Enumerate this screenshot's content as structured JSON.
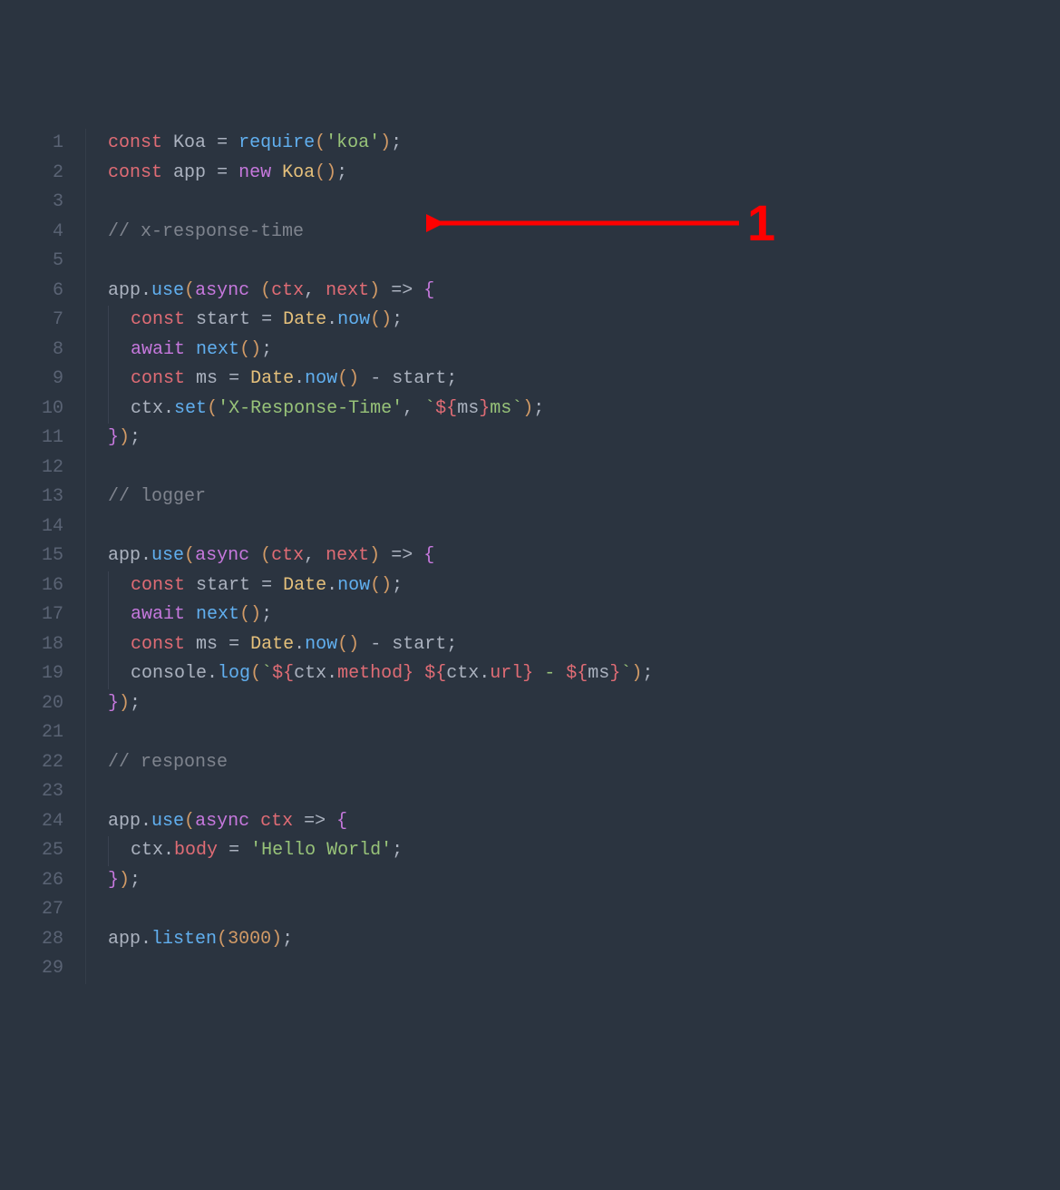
{
  "editor": {
    "lineCount": 29,
    "code": {
      "line1": [
        [
          "storage",
          "const"
        ],
        [
          "space",
          " "
        ],
        [
          "ident",
          "Koa"
        ],
        [
          "space",
          " "
        ],
        [
          "op",
          "="
        ],
        [
          "space",
          " "
        ],
        [
          "func",
          "require"
        ],
        [
          "paren",
          "("
        ],
        [
          "string",
          "'koa'"
        ],
        [
          "paren",
          ")"
        ],
        [
          "punct",
          ";"
        ]
      ],
      "line2": [
        [
          "storage",
          "const"
        ],
        [
          "space",
          " "
        ],
        [
          "ident",
          "app"
        ],
        [
          "space",
          " "
        ],
        [
          "op",
          "="
        ],
        [
          "space",
          " "
        ],
        [
          "keyword",
          "new"
        ],
        [
          "space",
          " "
        ],
        [
          "class",
          "Koa"
        ],
        [
          "paren",
          "()"
        ],
        [
          "punct",
          ";"
        ]
      ],
      "line3": [],
      "line4": [
        [
          "comment",
          "// x-response-time"
        ]
      ],
      "line5": [],
      "line6": [
        [
          "ident",
          "app"
        ],
        [
          "punct",
          "."
        ],
        [
          "func",
          "use"
        ],
        [
          "paren",
          "("
        ],
        [
          "keyword",
          "async"
        ],
        [
          "space",
          " "
        ],
        [
          "paren",
          "("
        ],
        [
          "prop",
          "ctx"
        ],
        [
          "punct",
          ","
        ],
        [
          "space",
          " "
        ],
        [
          "prop",
          "next"
        ],
        [
          "paren",
          ")"
        ],
        [
          "space",
          " "
        ],
        [
          "op",
          "=>"
        ],
        [
          "space",
          " "
        ],
        [
          "brace",
          "{"
        ]
      ],
      "line7": [
        [
          "indent",
          "  "
        ],
        [
          "storage",
          "const"
        ],
        [
          "space",
          " "
        ],
        [
          "ident",
          "start"
        ],
        [
          "space",
          " "
        ],
        [
          "op",
          "="
        ],
        [
          "space",
          " "
        ],
        [
          "class",
          "Date"
        ],
        [
          "punct",
          "."
        ],
        [
          "func",
          "now"
        ],
        [
          "paren",
          "()"
        ],
        [
          "punct",
          ";"
        ]
      ],
      "line8": [
        [
          "indent",
          "  "
        ],
        [
          "keyword",
          "await"
        ],
        [
          "space",
          " "
        ],
        [
          "func",
          "next"
        ],
        [
          "paren",
          "()"
        ],
        [
          "punct",
          ";"
        ]
      ],
      "line9": [
        [
          "indent",
          "  "
        ],
        [
          "storage",
          "const"
        ],
        [
          "space",
          " "
        ],
        [
          "ident",
          "ms"
        ],
        [
          "space",
          " "
        ],
        [
          "op",
          "="
        ],
        [
          "space",
          " "
        ],
        [
          "class",
          "Date"
        ],
        [
          "punct",
          "."
        ],
        [
          "func",
          "now"
        ],
        [
          "paren",
          "()"
        ],
        [
          "space",
          " "
        ],
        [
          "op",
          "-"
        ],
        [
          "space",
          " "
        ],
        [
          "ident",
          "start"
        ],
        [
          "punct",
          ";"
        ]
      ],
      "line10": [
        [
          "indent",
          "  "
        ],
        [
          "ident",
          "ctx"
        ],
        [
          "punct",
          "."
        ],
        [
          "func",
          "set"
        ],
        [
          "paren",
          "("
        ],
        [
          "string",
          "'X-Response-Time'"
        ],
        [
          "punct",
          ","
        ],
        [
          "space",
          " "
        ],
        [
          "template",
          "`"
        ],
        [
          "interp",
          "${"
        ],
        [
          "ident",
          "ms"
        ],
        [
          "interp",
          "}"
        ],
        [
          "template",
          "ms`"
        ],
        [
          "paren",
          ")"
        ],
        [
          "punct",
          ";"
        ]
      ],
      "line11": [
        [
          "brace",
          "}"
        ],
        [
          "paren",
          ")"
        ],
        [
          "punct",
          ";"
        ]
      ],
      "line12": [],
      "line13": [
        [
          "comment",
          "// logger"
        ]
      ],
      "line14": [],
      "line15": [
        [
          "ident",
          "app"
        ],
        [
          "punct",
          "."
        ],
        [
          "func",
          "use"
        ],
        [
          "paren",
          "("
        ],
        [
          "keyword",
          "async"
        ],
        [
          "space",
          " "
        ],
        [
          "paren",
          "("
        ],
        [
          "prop",
          "ctx"
        ],
        [
          "punct",
          ","
        ],
        [
          "space",
          " "
        ],
        [
          "prop",
          "next"
        ],
        [
          "paren",
          ")"
        ],
        [
          "space",
          " "
        ],
        [
          "op",
          "=>"
        ],
        [
          "space",
          " "
        ],
        [
          "brace",
          "{"
        ]
      ],
      "line16": [
        [
          "indent",
          "  "
        ],
        [
          "storage",
          "const"
        ],
        [
          "space",
          " "
        ],
        [
          "ident",
          "start"
        ],
        [
          "space",
          " "
        ],
        [
          "op",
          "="
        ],
        [
          "space",
          " "
        ],
        [
          "class",
          "Date"
        ],
        [
          "punct",
          "."
        ],
        [
          "func",
          "now"
        ],
        [
          "paren",
          "()"
        ],
        [
          "punct",
          ";"
        ]
      ],
      "line17": [
        [
          "indent",
          "  "
        ],
        [
          "keyword",
          "await"
        ],
        [
          "space",
          " "
        ],
        [
          "func",
          "next"
        ],
        [
          "paren",
          "()"
        ],
        [
          "punct",
          ";"
        ]
      ],
      "line18": [
        [
          "indent",
          "  "
        ],
        [
          "storage",
          "const"
        ],
        [
          "space",
          " "
        ],
        [
          "ident",
          "ms"
        ],
        [
          "space",
          " "
        ],
        [
          "op",
          "="
        ],
        [
          "space",
          " "
        ],
        [
          "class",
          "Date"
        ],
        [
          "punct",
          "."
        ],
        [
          "func",
          "now"
        ],
        [
          "paren",
          "()"
        ],
        [
          "space",
          " "
        ],
        [
          "op",
          "-"
        ],
        [
          "space",
          " "
        ],
        [
          "ident",
          "start"
        ],
        [
          "punct",
          ";"
        ]
      ],
      "line19": [
        [
          "indent",
          "  "
        ],
        [
          "ident",
          "console"
        ],
        [
          "punct",
          "."
        ],
        [
          "func",
          "log"
        ],
        [
          "paren",
          "("
        ],
        [
          "template",
          "`"
        ],
        [
          "interp",
          "${"
        ],
        [
          "ident",
          "ctx"
        ],
        [
          "punct",
          "."
        ],
        [
          "prop",
          "method"
        ],
        [
          "interp",
          "}"
        ],
        [
          "template",
          " "
        ],
        [
          "interp",
          "${"
        ],
        [
          "ident",
          "ctx"
        ],
        [
          "punct",
          "."
        ],
        [
          "prop",
          "url"
        ],
        [
          "interp",
          "}"
        ],
        [
          "template",
          " - "
        ],
        [
          "interp",
          "${"
        ],
        [
          "ident",
          "ms"
        ],
        [
          "interp",
          "}"
        ],
        [
          "template",
          "`"
        ],
        [
          "paren",
          ")"
        ],
        [
          "punct",
          ";"
        ]
      ],
      "line20": [
        [
          "brace",
          "}"
        ],
        [
          "paren",
          ")"
        ],
        [
          "punct",
          ";"
        ]
      ],
      "line21": [],
      "line22": [
        [
          "comment",
          "// response"
        ]
      ],
      "line23": [],
      "line24": [
        [
          "ident",
          "app"
        ],
        [
          "punct",
          "."
        ],
        [
          "func",
          "use"
        ],
        [
          "paren",
          "("
        ],
        [
          "keyword",
          "async"
        ],
        [
          "space",
          " "
        ],
        [
          "prop",
          "ctx"
        ],
        [
          "space",
          " "
        ],
        [
          "op",
          "=>"
        ],
        [
          "space",
          " "
        ],
        [
          "brace",
          "{"
        ]
      ],
      "line25": [
        [
          "indent",
          "  "
        ],
        [
          "ident",
          "ctx"
        ],
        [
          "punct",
          "."
        ],
        [
          "prop",
          "body"
        ],
        [
          "space",
          " "
        ],
        [
          "op",
          "="
        ],
        [
          "space",
          " "
        ],
        [
          "string",
          "'Hello World'"
        ],
        [
          "punct",
          ";"
        ]
      ],
      "line26": [
        [
          "brace",
          "}"
        ],
        [
          "paren",
          ")"
        ],
        [
          "punct",
          ";"
        ]
      ],
      "line27": [],
      "line28": [
        [
          "ident",
          "app"
        ],
        [
          "punct",
          "."
        ],
        [
          "func",
          "listen"
        ],
        [
          "paren",
          "("
        ],
        [
          "number",
          "3000"
        ],
        [
          "paren",
          ")"
        ],
        [
          "punct",
          ";"
        ]
      ],
      "line29": []
    }
  },
  "annotation": {
    "label": "1",
    "targetLine": 7,
    "color": "#ff0000"
  }
}
